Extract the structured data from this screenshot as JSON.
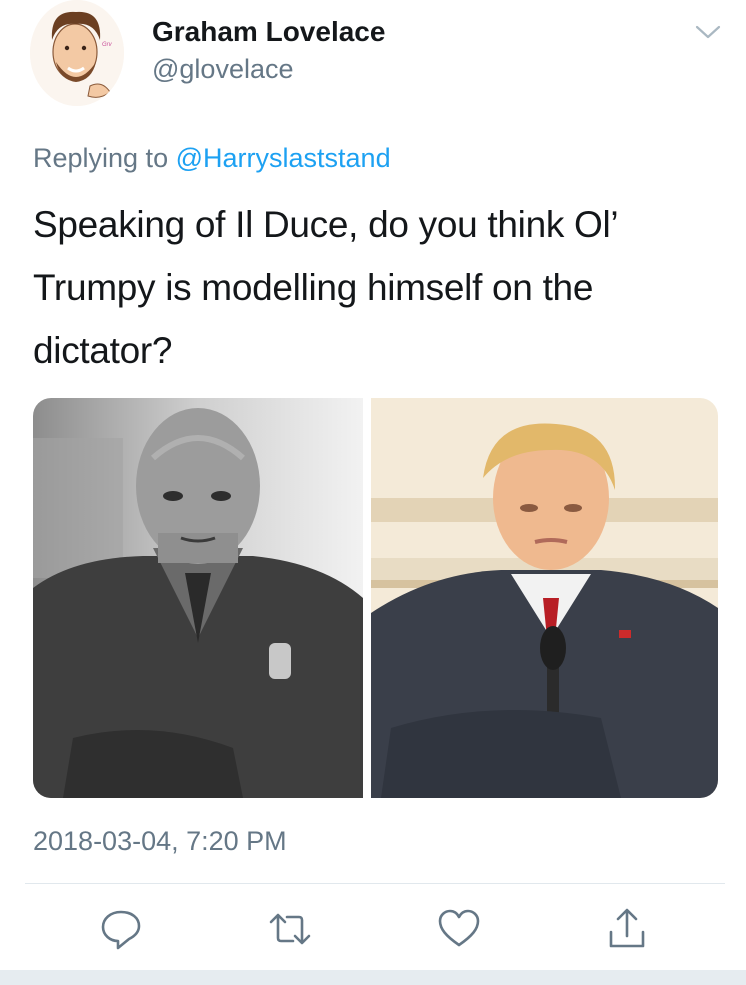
{
  "tweet": {
    "author_name": "Graham Lovelace",
    "author_handle": "@glovelace",
    "replying_prefix": "Replying to",
    "replying_to": "@Harryslaststand",
    "text": "Speaking of Il Duce, do you think Ol’ Trumpy is modelling himself on the dictator?",
    "timestamp": "2018-03-04, 7:20 PM",
    "avatar_signature": "Grv"
  },
  "icons": {
    "menu": "chevron-down-icon",
    "reply": "reply-icon",
    "retweet": "retweet-icon",
    "like": "heart-icon",
    "share": "share-icon"
  },
  "colors": {
    "link": "#1da1f2",
    "secondary_text": "#657786",
    "primary_text": "#14171a",
    "divider": "#e1e8ed"
  }
}
